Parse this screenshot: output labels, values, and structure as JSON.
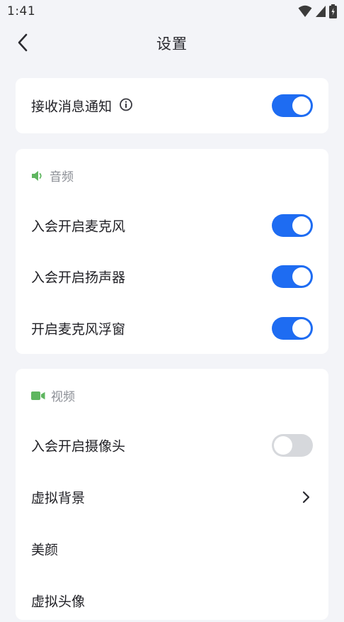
{
  "status_bar": {
    "time": "1:41"
  },
  "nav": {
    "title": "设置"
  },
  "notifications": {
    "label": "接收消息通知",
    "enabled": true
  },
  "audio": {
    "section_label": "音频",
    "accent_color": "#5fb660",
    "items": [
      {
        "label": "入会开启麦克风",
        "enabled": true
      },
      {
        "label": "入会开启扬声器",
        "enabled": true
      },
      {
        "label": "开启麦克风浮窗",
        "enabled": true
      }
    ]
  },
  "video": {
    "section_label": "视频",
    "accent_color": "#5fb660",
    "items": [
      {
        "label": "入会开启摄像头",
        "enabled": false
      },
      {
        "label": "虚拟背景"
      },
      {
        "label": "美颜"
      },
      {
        "label": "虚拟头像"
      }
    ]
  },
  "colors": {
    "toggle_on": "#1e6cf2",
    "toggle_off": "#d6d8dc",
    "background": "#f3f4f8"
  }
}
